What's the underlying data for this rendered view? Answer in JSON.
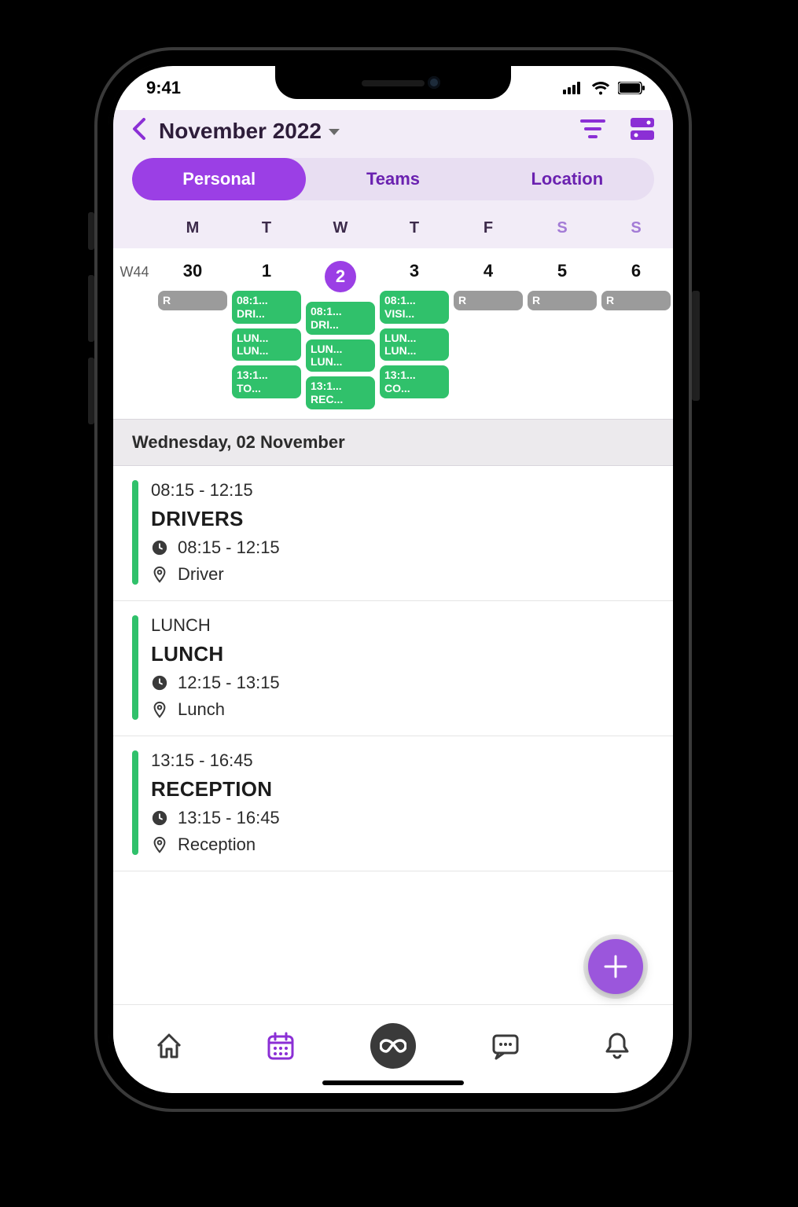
{
  "status": {
    "time": "9:41"
  },
  "header": {
    "title": "November 2022",
    "tabs": [
      {
        "label": "Personal",
        "active": true
      },
      {
        "label": "Teams",
        "active": false
      },
      {
        "label": "Location",
        "active": false
      }
    ]
  },
  "weekdays": [
    "M",
    "T",
    "W",
    "T",
    "F",
    "S",
    "S"
  ],
  "week": {
    "label": "W44",
    "days": [
      {
        "num": "30",
        "selected": false,
        "pills": [
          {
            "type": "r",
            "l1": "R"
          }
        ]
      },
      {
        "num": "1",
        "selected": false,
        "pills": [
          {
            "type": "g",
            "l1": "08:1...",
            "l2": "DRI..."
          },
          {
            "type": "g",
            "l1": "LUN...",
            "l2": "LUN..."
          },
          {
            "type": "g",
            "l1": "13:1...",
            "l2": "TO..."
          }
        ]
      },
      {
        "num": "2",
        "selected": true,
        "pills": [
          {
            "type": "g",
            "l1": "08:1...",
            "l2": "DRI..."
          },
          {
            "type": "g",
            "l1": "LUN...",
            "l2": "LUN..."
          },
          {
            "type": "g",
            "l1": "13:1...",
            "l2": "REC..."
          }
        ]
      },
      {
        "num": "3",
        "selected": false,
        "pills": [
          {
            "type": "g",
            "l1": "08:1...",
            "l2": "VISI..."
          },
          {
            "type": "g",
            "l1": "LUN...",
            "l2": "LUN..."
          },
          {
            "type": "g",
            "l1": "13:1...",
            "l2": "CO..."
          }
        ]
      },
      {
        "num": "4",
        "selected": false,
        "pills": [
          {
            "type": "r",
            "l1": "R"
          }
        ]
      },
      {
        "num": "5",
        "selected": false,
        "pills": [
          {
            "type": "r",
            "l1": "R"
          }
        ]
      },
      {
        "num": "6",
        "selected": false,
        "pills": [
          {
            "type": "r",
            "l1": "R"
          }
        ]
      }
    ]
  },
  "selectedDate": "Wednesday, 02 November",
  "events": [
    {
      "top": "08:15 - 12:15",
      "title": "DRIVERS",
      "time": "08:15 - 12:15",
      "loc": "Driver"
    },
    {
      "top": "LUNCH",
      "title": "LUNCH",
      "time": "12:15 - 13:15",
      "loc": "Lunch"
    },
    {
      "top": "13:15 - 16:45",
      "title": "RECEPTION",
      "time": "13:15 - 16:45",
      "loc": "Reception"
    }
  ]
}
